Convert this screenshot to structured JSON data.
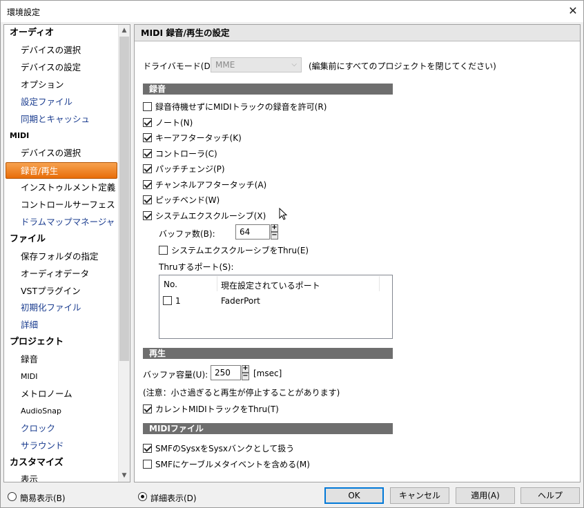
{
  "window": {
    "title": "環境設定",
    "close_glyph": "✕"
  },
  "sidebar": {
    "items": [
      {
        "label": "オーディオ",
        "kind": "cat"
      },
      {
        "label": "デバイスの選択",
        "kind": "sub"
      },
      {
        "label": "デバイスの設定",
        "kind": "sub"
      },
      {
        "label": "オプション",
        "kind": "sub"
      },
      {
        "label": "設定ファイル",
        "kind": "link"
      },
      {
        "label": "同期とキャッシュ",
        "kind": "link"
      },
      {
        "label": "MIDI",
        "kind": "cat-small"
      },
      {
        "label": "デバイスの選択",
        "kind": "sub"
      },
      {
        "label": "録音/再生",
        "kind": "selected"
      },
      {
        "label": "インストゥルメント定義",
        "kind": "sub"
      },
      {
        "label": "コントロールサーフェス",
        "kind": "sub"
      },
      {
        "label": "ドラムマップマネージャ",
        "kind": "link"
      },
      {
        "label": "ファイル",
        "kind": "cat"
      },
      {
        "label": "保存フォルダの指定",
        "kind": "sub"
      },
      {
        "label": "オーディオデータ",
        "kind": "sub"
      },
      {
        "label": "VSTプラグイン",
        "kind": "sub"
      },
      {
        "label": "初期化ファイル",
        "kind": "link"
      },
      {
        "label": "詳細",
        "kind": "link"
      },
      {
        "label": "プロジェクト",
        "kind": "cat"
      },
      {
        "label": "録音",
        "kind": "sub"
      },
      {
        "label": "MIDI",
        "kind": "sub-small"
      },
      {
        "label": "メトロノーム",
        "kind": "sub"
      },
      {
        "label": "AudioSnap",
        "kind": "sub-small"
      },
      {
        "label": "クロック",
        "kind": "link"
      },
      {
        "label": "サラウンド",
        "kind": "link"
      },
      {
        "label": "カスタマイズ",
        "kind": "cat"
      },
      {
        "label": "表示",
        "kind": "sub"
      }
    ]
  },
  "panel": {
    "title": "MIDI 録音/再生の設定",
    "driver_mode": {
      "label": "ドライバモード(D):",
      "value": "MME",
      "note": "(編集前にすべてのプロジェクトを閉じてください)"
    },
    "record_section": "録音",
    "record_options": [
      {
        "label": "録音待機せずにMIDIトラックの録音を許可(R)",
        "checked": false
      },
      {
        "label": "ノート(N)",
        "checked": true
      },
      {
        "label": "キーアフタータッチ(K)",
        "checked": true
      },
      {
        "label": "コントローラ(C)",
        "checked": true
      },
      {
        "label": "パッチチェンジ(P)",
        "checked": true
      },
      {
        "label": "チャンネルアフタータッチ(A)",
        "checked": true
      },
      {
        "label": "ピッチベンド(W)",
        "checked": true
      },
      {
        "label": "システムエクスクルーシブ(X)",
        "checked": true
      }
    ],
    "buffer_count": {
      "label": "バッファ数(B):",
      "value": "64"
    },
    "sysex_thru": {
      "label": "システムエクスクルーシブをThru(E)",
      "checked": false
    },
    "thru_ports_label": "Thruするポート(S):",
    "ports_table": {
      "headers": [
        "No.",
        "現在設定されているポート"
      ],
      "rows": [
        {
          "no": "1",
          "port": "FaderPort",
          "checked": false
        }
      ]
    },
    "playback_section": "再生",
    "buffer_size": {
      "label": "バッファ容量(U):",
      "value": "250",
      "unit": "[msec]"
    },
    "playback_note": "(注意：小さ過ぎると再生が停止することがあります)",
    "current_thru": {
      "label": "カレントMIDIトラックをThru(T)",
      "checked": true
    },
    "midifile_section": "MIDIファイル",
    "midifile_options": [
      {
        "label": "SMFのSysxをSysxバンクとして扱う",
        "checked": true
      },
      {
        "label": "SMFにケーブルメタイベントを含める(M)",
        "checked": false
      }
    ]
  },
  "footer": {
    "simple_view": {
      "label": "簡易表示(B)",
      "selected": false
    },
    "detail_view": {
      "label": "詳細表示(D)",
      "selected": true
    },
    "buttons": {
      "ok": "OK",
      "cancel": "キャンセル",
      "apply": "適用(A)",
      "help": "ヘルプ"
    }
  },
  "colors": {
    "selection": "#e86d09",
    "section_header": "#6e6e6e",
    "link": "#1a3c8f",
    "default_button_border": "#0078d7"
  }
}
